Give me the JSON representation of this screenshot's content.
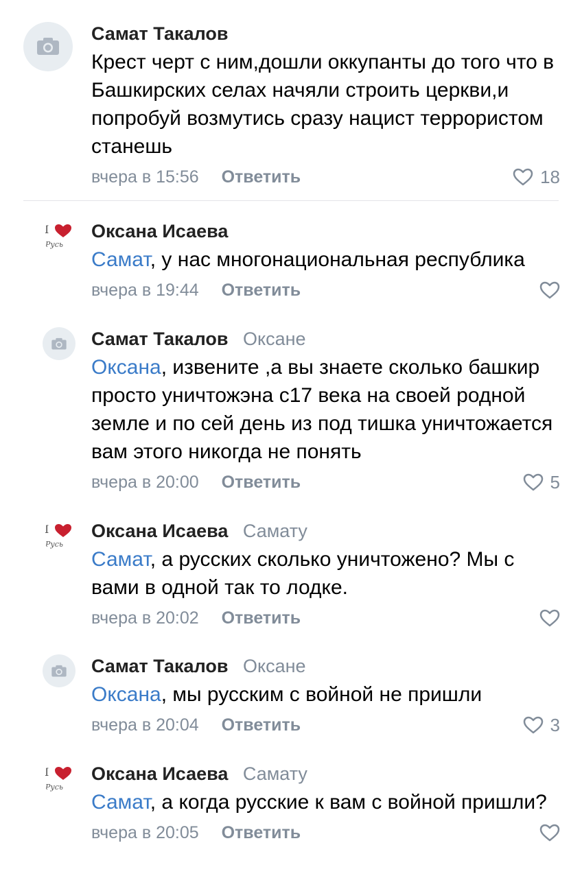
{
  "comments": [
    {
      "author": "Самат Такалов",
      "reply_to": "",
      "mention": "",
      "text": "Крест черт с ним,дошли оккупанты до того что в Башкирских селах начяли  строить церкви,и попробуй возмутись сразу нацист террористом станешь",
      "time": "вчера в 15:56",
      "reply_label": "Ответить",
      "likes": "18",
      "avatar": "camera-icon"
    },
    {
      "author": "Оксана Исаева",
      "reply_to": "",
      "mention": "Самат",
      "text": ", у нас многонациональная республика",
      "time": "вчера в 19:44",
      "reply_label": "Ответить",
      "likes": "",
      "avatar": "heart-logo"
    },
    {
      "author": "Самат Такалов",
      "reply_to": "Оксане",
      "mention": "Оксана",
      "text": ", извените ,а вы знаете сколько башкир просто уничтожэна с17 века на своей родной земле и по сей день из под тишка уничтожается вам этого никогда не понять",
      "time": "вчера в 20:00",
      "reply_label": "Ответить",
      "likes": "5",
      "avatar": "camera-icon"
    },
    {
      "author": "Оксана Исаева",
      "reply_to": "Самату",
      "mention": "Самат",
      "text": ", а русских сколько уничтожено? Мы с вами в одной так то лодке.",
      "time": "вчера в 20:02",
      "reply_label": "Ответить",
      "likes": "",
      "avatar": "heart-logo"
    },
    {
      "author": "Самат Такалов",
      "reply_to": "Оксане",
      "mention": "Оксана",
      "text": ", мы русским с войной не пришли",
      "time": "вчера в 20:04",
      "reply_label": "Ответить",
      "likes": "3",
      "avatar": "camera-icon"
    },
    {
      "author": "Оксана Исаева",
      "reply_to": "Самату",
      "mention": "Самат",
      "text": ", а когда русские к вам с войной пришли?",
      "time": "вчера в 20:05",
      "reply_label": "Ответить",
      "likes": "",
      "avatar": "heart-logo"
    }
  ],
  "colors": {
    "mention": "#3a7bc8",
    "meta": "#818c99",
    "avatar_bg": "#e8edf1",
    "heart_logo": "#c8202f"
  }
}
